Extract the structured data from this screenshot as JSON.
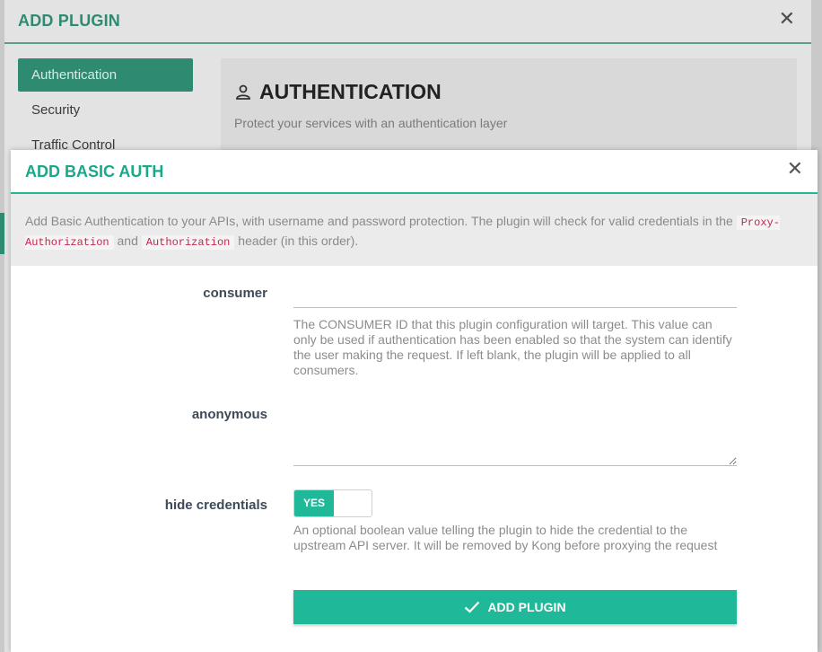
{
  "background_dialog": {
    "title": "ADD PLUGIN",
    "close_icon": "close-icon",
    "nav": [
      {
        "label": "Authentication",
        "active": true
      },
      {
        "label": "Security",
        "active": false
      },
      {
        "label": "Traffic Control",
        "active": false
      }
    ],
    "panel": {
      "icon": "user-icon",
      "title": "AUTHENTICATION",
      "subtitle": "Protect your services with an authentication layer"
    }
  },
  "modal": {
    "title": "ADD BASIC AUTH",
    "close_icon": "close-icon",
    "description": {
      "part1": "Add Basic Authentication to your APIs, with username and password protection. The plugin will check for valid credentials in the ",
      "code1": "Proxy-Authorization",
      "part2": " and ",
      "code2": "Authorization",
      "part3": " header (in this order)."
    },
    "fields": {
      "consumer": {
        "label": "consumer",
        "value": "",
        "help": "The CONSUMER ID that this plugin configuration will target. This value can only be used if authentication has been enabled so that the system can identify the user making the request. If left blank, the plugin will be applied to all consumers."
      },
      "anonymous": {
        "label": "anonymous",
        "value": ""
      },
      "hide_credentials": {
        "label": "hide credentials",
        "toggle_label": "YES",
        "enabled": true,
        "help": "An optional boolean value telling the plugin to hide the credential to the upstream API server. It will be removed by Kong before proxying the request"
      }
    },
    "submit_label": "ADD PLUGIN"
  },
  "colors": {
    "accent": "#1fb899",
    "accent_dark": "#1aa88a",
    "code_text": "#c7254e"
  }
}
